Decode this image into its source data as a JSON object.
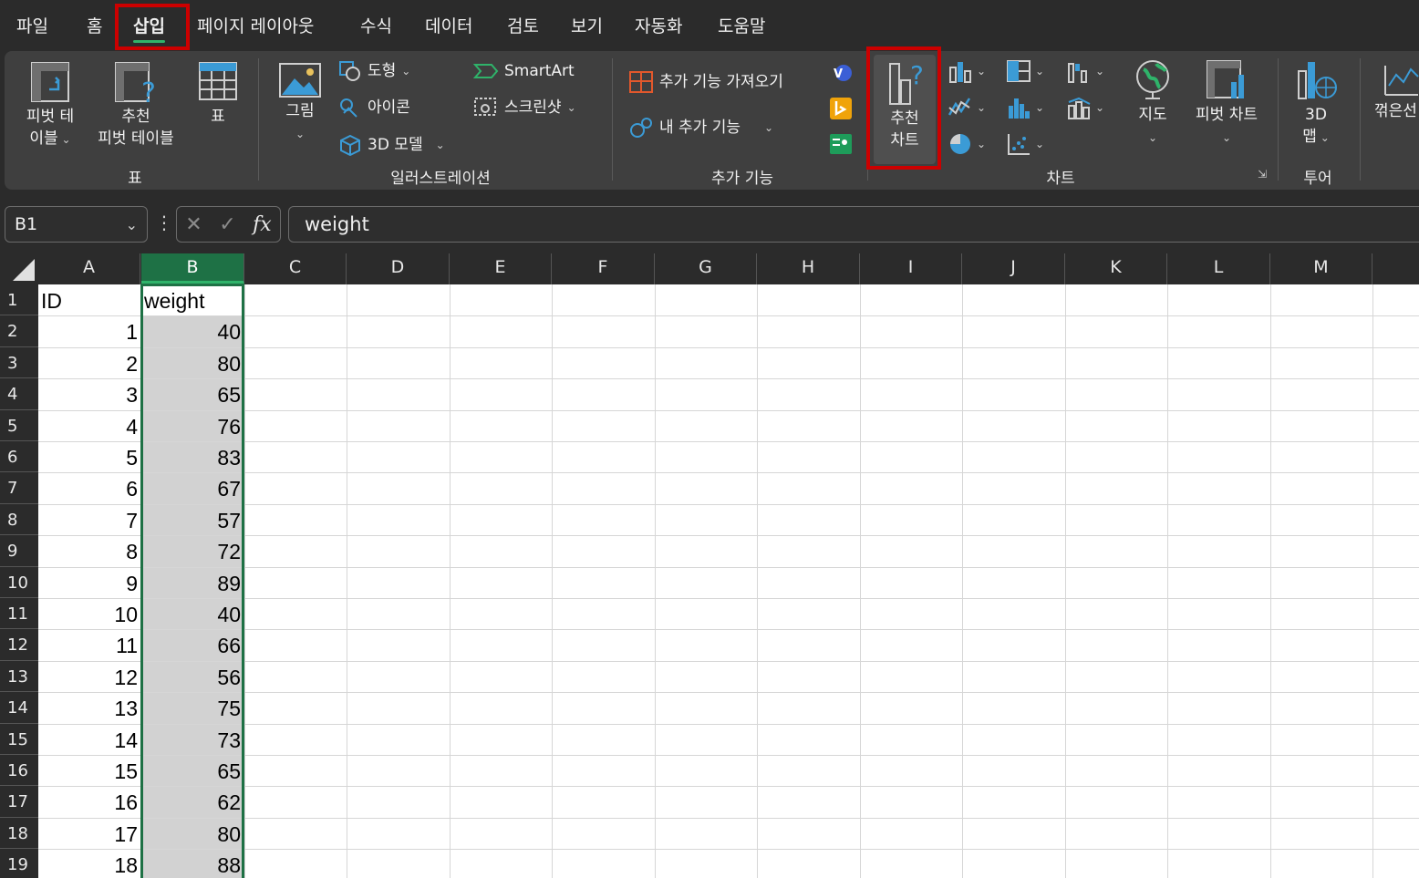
{
  "menu": {
    "tabs": [
      {
        "label": "파일"
      },
      {
        "label": "홈"
      },
      {
        "label": "삽입",
        "active": true
      },
      {
        "label": "페이지 레이아웃"
      },
      {
        "label": "수식"
      },
      {
        "label": "데이터"
      },
      {
        "label": "검토"
      },
      {
        "label": "보기"
      },
      {
        "label": "자동화"
      },
      {
        "label": "도움말"
      }
    ]
  },
  "ribbon": {
    "tables": {
      "pivot_table_line1": "피벗 테",
      "pivot_table_line2": "이블",
      "recommended_pivot_line1": "추천",
      "recommended_pivot_line2": "피벗 테이블",
      "table": "표",
      "group_label": "표"
    },
    "illustrations": {
      "picture": "그림",
      "shapes": "도형",
      "icons": "아이콘",
      "models_3d": "3D 모델",
      "smartart": "SmartArt",
      "screenshot": "스크린샷",
      "group_label": "일러스트레이션"
    },
    "addins": {
      "get_addins": "추가 기능 가져오기",
      "my_addins": "내 추가 기능",
      "group_label": "추가 기능"
    },
    "charts": {
      "recommended_line1": "추천",
      "recommended_line2": "차트",
      "maps": "지도",
      "pivot_chart": "피벗 차트",
      "group_label": "차트"
    },
    "tours": {
      "map3d_line1": "3D",
      "map3d_line2": "맵",
      "group_label": "투어"
    },
    "sparklines": {
      "line_partial": "꺾은선"
    }
  },
  "formula_bar": {
    "name_box": "B1",
    "formula": "weight"
  },
  "sheet": {
    "columns": [
      "A",
      "B",
      "C",
      "D",
      "E",
      "F",
      "G",
      "H",
      "I",
      "J",
      "K",
      "L",
      "M"
    ],
    "selected_column": "B",
    "row_numbers": [
      "1",
      "2",
      "3",
      "4",
      "5",
      "6",
      "7",
      "8",
      "9",
      "10",
      "11",
      "12",
      "13",
      "14",
      "15",
      "16",
      "17",
      "18",
      "19"
    ],
    "header": {
      "A": "ID",
      "B": "weight"
    },
    "rows": [
      {
        "id": "1",
        "weight": "40"
      },
      {
        "id": "2",
        "weight": "80"
      },
      {
        "id": "3",
        "weight": "65"
      },
      {
        "id": "4",
        "weight": "76"
      },
      {
        "id": "5",
        "weight": "83"
      },
      {
        "id": "6",
        "weight": "67"
      },
      {
        "id": "7",
        "weight": "57"
      },
      {
        "id": "8",
        "weight": "72"
      },
      {
        "id": "9",
        "weight": "89"
      },
      {
        "id": "10",
        "weight": "40"
      },
      {
        "id": "11",
        "weight": "66"
      },
      {
        "id": "12",
        "weight": "56"
      },
      {
        "id": "13",
        "weight": "75"
      },
      {
        "id": "14",
        "weight": "73"
      },
      {
        "id": "15",
        "weight": "65"
      },
      {
        "id": "16",
        "weight": "62"
      },
      {
        "id": "17",
        "weight": "80"
      },
      {
        "id": "18",
        "weight": "88"
      }
    ]
  },
  "colors": {
    "highlight": "#cc0000",
    "excel_green": "#1e7145",
    "accent_green": "#2fb36a",
    "selection_fill": "#d2d2d2"
  }
}
